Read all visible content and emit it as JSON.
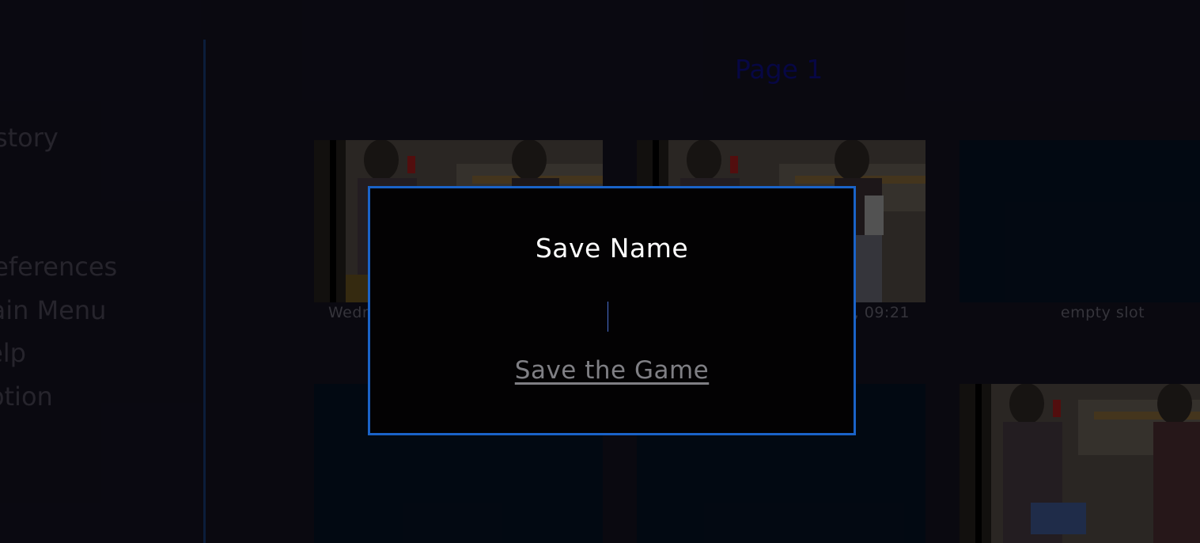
{
  "nav": {
    "items": [
      {
        "label": "History"
      },
      {
        "label": "Preferences"
      },
      {
        "label": "Main Menu"
      },
      {
        "label": "Help"
      },
      {
        "label": "Option"
      }
    ]
  },
  "page": {
    "title": "Page 1"
  },
  "slots": [
    {
      "caption": "Wednesday, ... 09:21",
      "empty": false
    },
    {
      "caption": "Wednesday, ... 09:21",
      "empty": false
    },
    {
      "caption": "empty slot",
      "empty": true
    },
    {
      "caption": "",
      "empty": true
    },
    {
      "caption": "",
      "empty": true
    },
    {
      "caption": "",
      "empty": false
    }
  ],
  "slot_captions_visible": {
    "left": "Wedr",
    "middle": ", 09:21",
    "right": "empty slot"
  },
  "modal": {
    "title": "Save Name",
    "input_value": "",
    "save_label": "Save the Game"
  },
  "colors": {
    "accent": "#1a63c8",
    "page_title": "#08084a",
    "modal_bg": "#030203"
  }
}
